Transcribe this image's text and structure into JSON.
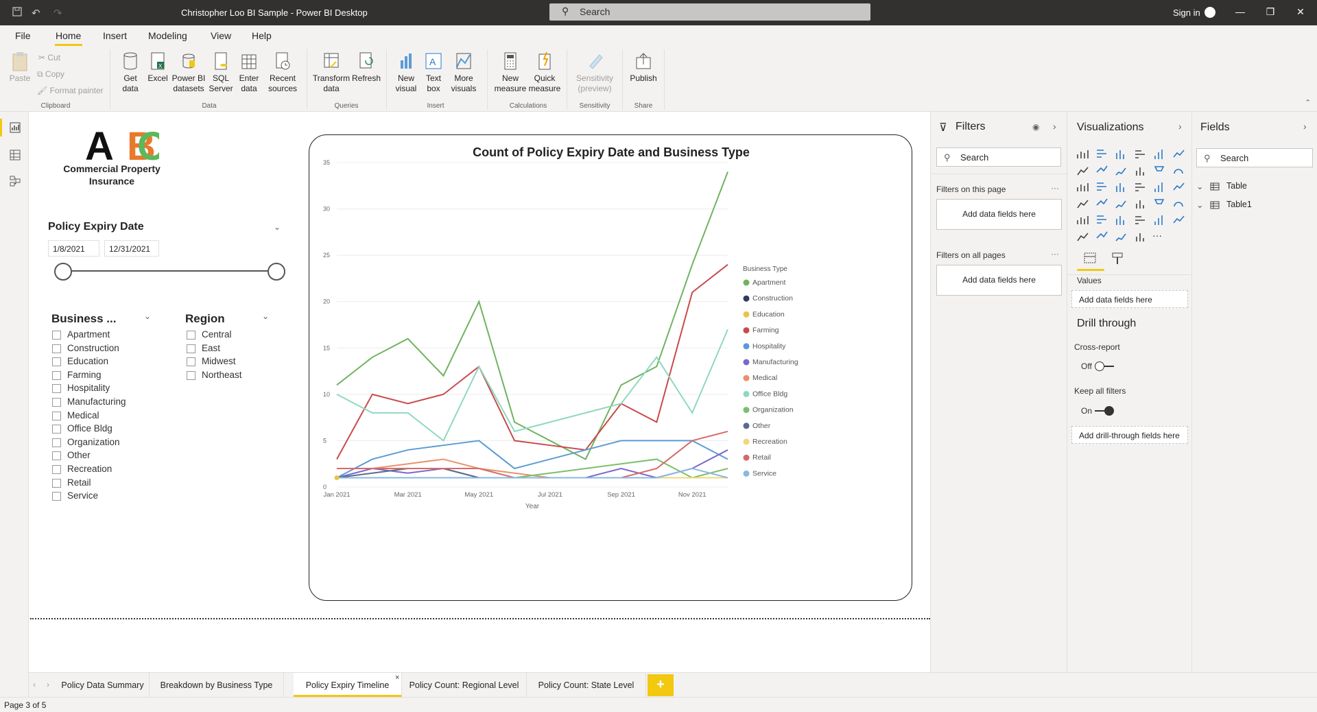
{
  "app": {
    "title": "Christopher Loo BI Sample - Power BI Desktop",
    "search_placeholder": "Search",
    "signin": "Sign in"
  },
  "menu": [
    "File",
    "Home",
    "Insert",
    "Modeling",
    "View",
    "Help"
  ],
  "ribbon": {
    "paste": "Paste",
    "cut": "Cut",
    "copy": "Copy",
    "format_painter": "Format painter",
    "get_data": "Get\ndata",
    "excel": "Excel",
    "pbi_datasets": "Power BI\ndatasets",
    "sql_server": "SQL\nServer",
    "enter_data": "Enter\ndata",
    "recent_sources": "Recent\nsources",
    "transform_data": "Transform\ndata",
    "refresh": "Refresh",
    "new_visual": "New\nvisual",
    "text_box": "Text\nbox",
    "more_visuals": "More\nvisuals",
    "new_measure": "New\nmeasure",
    "quick_measure": "Quick\nmeasure",
    "sensitivity": "Sensitivity\n(preview)",
    "publish": "Publish",
    "groups": {
      "clipboard": "Clipboard",
      "data": "Data",
      "queries": "Queries",
      "insert": "Insert",
      "calculations": "Calculations",
      "sensitivity": "Sensitivity",
      "share": "Share"
    }
  },
  "report": {
    "logo_text": "Commercial Property Insurance",
    "date_slicer": {
      "title": "Policy Expiry Date",
      "start": "1/8/2021",
      "end": "12/31/2021"
    },
    "business_slicer": {
      "title": "Business ...",
      "items": [
        "Apartment",
        "Construction",
        "Education",
        "Farming",
        "Hospitality",
        "Manufacturing",
        "Medical",
        "Office Bldg",
        "Organization",
        "Other",
        "Recreation",
        "Retail",
        "Service"
      ]
    },
    "region_slicer": {
      "title": "Region",
      "items": [
        "Central",
        "East",
        "Midwest",
        "Northeast"
      ]
    }
  },
  "chart_data": {
    "type": "line",
    "title": "Count of Policy Expiry Date and Business Type",
    "xlabel": "Year",
    "ylabel": "",
    "x": [
      "2021-01",
      "2021-02",
      "2021-03",
      "2021-04",
      "2021-05",
      "2021-06",
      "2021-07",
      "2021-08",
      "2021-09",
      "2021-10",
      "2021-11",
      "2021-12"
    ],
    "x_tick_labels": [
      "Jan 2021",
      "Mar 2021",
      "May 2021",
      "Jul 2021",
      "Sep 2021",
      "Nov 2021"
    ],
    "x_tick_indices": [
      0,
      2,
      4,
      6,
      8,
      10
    ],
    "ylim": [
      0,
      35
    ],
    "y_ticks": [
      0,
      5,
      10,
      15,
      20,
      25,
      30,
      35
    ],
    "grid": true,
    "legend_title": "Business Type",
    "legend_position": "right",
    "series": [
      {
        "name": "Apartment",
        "color": "#6fb35f",
        "values": [
          11,
          14,
          16,
          12,
          20,
          7,
          5,
          3,
          11,
          13,
          24,
          34
        ]
      },
      {
        "name": "Construction",
        "color": "#2e3b63",
        "values": [
          1,
          1,
          1,
          1,
          1,
          1,
          1,
          1,
          1,
          1,
          1,
          1
        ]
      },
      {
        "name": "Education",
        "color": "#e8c547",
        "values": [
          1,
          1,
          1,
          1,
          1,
          1,
          1,
          1,
          1,
          1,
          1,
          1
        ]
      },
      {
        "name": "Farming",
        "color": "#c94a4a",
        "values": [
          3,
          10,
          9,
          10,
          13,
          5,
          4.5,
          4,
          9,
          7,
          21,
          24
        ]
      },
      {
        "name": "Hospitality",
        "color": "#5b9bd5",
        "values": [
          1,
          3,
          4,
          4.5,
          5,
          2,
          3,
          4,
          5,
          5,
          5,
          3
        ]
      },
      {
        "name": "Manufacturing",
        "color": "#7b68c8",
        "values": [
          1,
          2,
          1.5,
          2,
          1,
          1,
          1,
          1,
          2,
          1,
          2,
          4
        ]
      },
      {
        "name": "Medical",
        "color": "#e8926a",
        "values": [
          2,
          2,
          2.5,
          3,
          2,
          1.5,
          1,
          1,
          1,
          1,
          1,
          1
        ]
      },
      {
        "name": "Office Bldg",
        "color": "#8fd8c0",
        "values": [
          10,
          8,
          8,
          5,
          13,
          6,
          7,
          8,
          9,
          14,
          8,
          17
        ]
      },
      {
        "name": "Organization",
        "color": "#7cbf6a",
        "values": [
          1,
          1,
          1,
          1,
          1,
          1,
          1.5,
          2,
          2.5,
          3,
          1,
          2
        ]
      },
      {
        "name": "Other",
        "color": "#5a6b8c",
        "values": [
          1,
          1.5,
          2,
          2,
          1,
          1,
          1,
          1,
          1,
          1,
          1,
          1
        ]
      },
      {
        "name": "Recreation",
        "color": "#f0d878",
        "values": [
          1,
          1,
          1,
          1,
          1,
          1,
          1,
          1,
          1,
          1,
          1,
          1
        ]
      },
      {
        "name": "Retail",
        "color": "#d66a6a",
        "values": [
          2,
          2,
          2,
          2,
          2,
          1,
          1,
          1,
          1,
          2,
          5,
          6
        ]
      },
      {
        "name": "Service",
        "color": "#8ab8e0",
        "values": [
          1,
          1,
          1,
          1,
          1,
          1,
          1,
          1,
          1,
          1,
          2,
          1
        ]
      }
    ]
  },
  "filters": {
    "title": "Filters",
    "search": "Search",
    "on_page": "Filters on this page",
    "on_all": "Filters on all pages",
    "add_fields": "Add data fields here"
  },
  "viz": {
    "title": "Visualizations",
    "values_label": "Values",
    "add_data_fields": "Add data fields here",
    "drill_through": "Drill through",
    "cross_report": "Cross-report",
    "cross_report_state": "Off",
    "keep_all_filters": "Keep all filters",
    "keep_all_state": "On",
    "add_drill_fields": "Add drill-through fields here"
  },
  "fields": {
    "title": "Fields",
    "search": "Search",
    "tables": [
      "Table",
      "Table1"
    ]
  },
  "pages": [
    "Policy Data Summary",
    "Breakdown by Business Type",
    "Policy Expiry Timeline",
    "Policy Count: Regional Level",
    "Policy Count: State Level"
  ],
  "active_page_index": 2,
  "status": "Page 3 of 5",
  "colors": {
    "accent": "#f2c811",
    "chrome_dark": "#323130"
  }
}
